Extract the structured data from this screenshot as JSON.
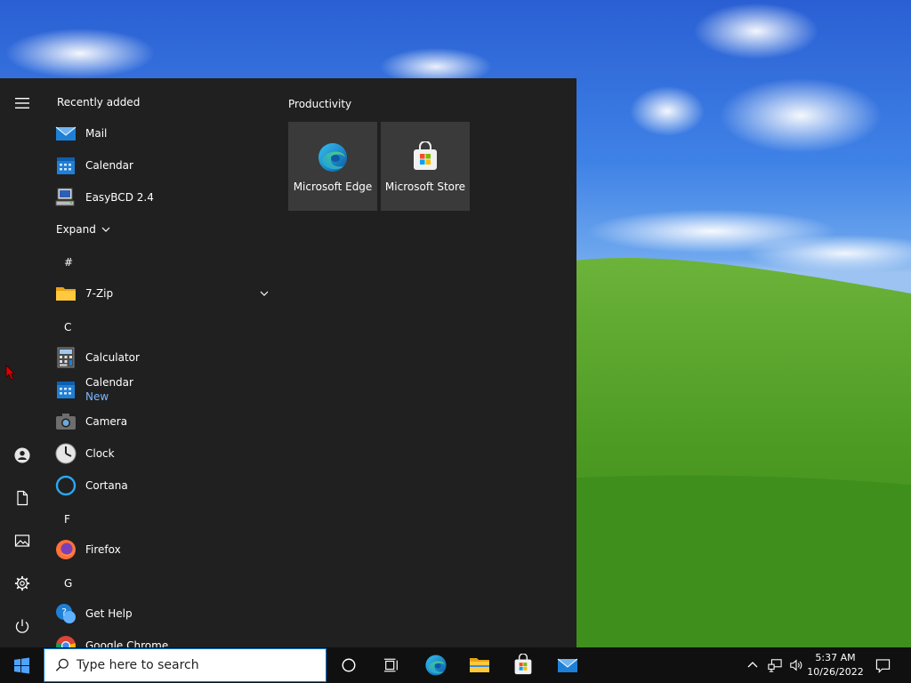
{
  "desktop": {
    "sky_color": "#3f82e6",
    "hill_color": "#4e9a2a"
  },
  "start_menu": {
    "rail": {
      "menu_icon": "hamburger-icon",
      "items": [
        {
          "name": "account",
          "icon": "user-icon"
        },
        {
          "name": "documents",
          "icon": "document-icon"
        },
        {
          "name": "pictures",
          "icon": "pictures-icon"
        },
        {
          "name": "settings",
          "icon": "gear-icon"
        },
        {
          "name": "power",
          "icon": "power-icon"
        }
      ]
    },
    "recently_added_label": "Recently added",
    "recently_added": [
      {
        "label": "Mail",
        "icon": "mail-icon"
      },
      {
        "label": "Calendar",
        "icon": "calendar-icon"
      },
      {
        "label": "EasyBCD 2.4",
        "icon": "easybcd-icon"
      }
    ],
    "expand_label": "Expand",
    "sections": {
      "hash": "#",
      "c": "C",
      "f": "F",
      "g": "G"
    },
    "apps": {
      "zip": {
        "label": "7-Zip",
        "icon": "folder-icon"
      },
      "calculator": {
        "label": "Calculator",
        "icon": "calculator-icon"
      },
      "calendar": {
        "label": "Calendar",
        "sub": "New",
        "icon": "calendar-icon"
      },
      "camera": {
        "label": "Camera",
        "icon": "camera-icon"
      },
      "clock": {
        "label": "Clock",
        "icon": "clock-icon"
      },
      "cortana": {
        "label": "Cortana",
        "icon": "cortana-icon"
      },
      "firefox": {
        "label": "Firefox",
        "icon": "firefox-icon"
      },
      "gethelp": {
        "label": "Get Help",
        "icon": "help-icon"
      },
      "chrome": {
        "label": "Google Chrome",
        "icon": "chrome-icon"
      }
    },
    "tiles_group": "Productivity",
    "tiles": [
      {
        "label": "Microsoft Edge",
        "icon": "edge-icon"
      },
      {
        "label": "Microsoft Store",
        "icon": "store-icon"
      }
    ]
  },
  "taskbar": {
    "search_placeholder": "Type here to search",
    "pinned": [
      {
        "name": "cortana",
        "icon": "cortana-circle-icon"
      },
      {
        "name": "task-view",
        "icon": "task-view-icon"
      },
      {
        "name": "edge",
        "icon": "edge-icon"
      },
      {
        "name": "file-explorer",
        "icon": "folder-icon"
      },
      {
        "name": "store",
        "icon": "store-icon"
      },
      {
        "name": "mail",
        "icon": "mail-icon"
      }
    ],
    "clock": {
      "time": "5:37 AM",
      "date": "10/26/2022"
    }
  }
}
